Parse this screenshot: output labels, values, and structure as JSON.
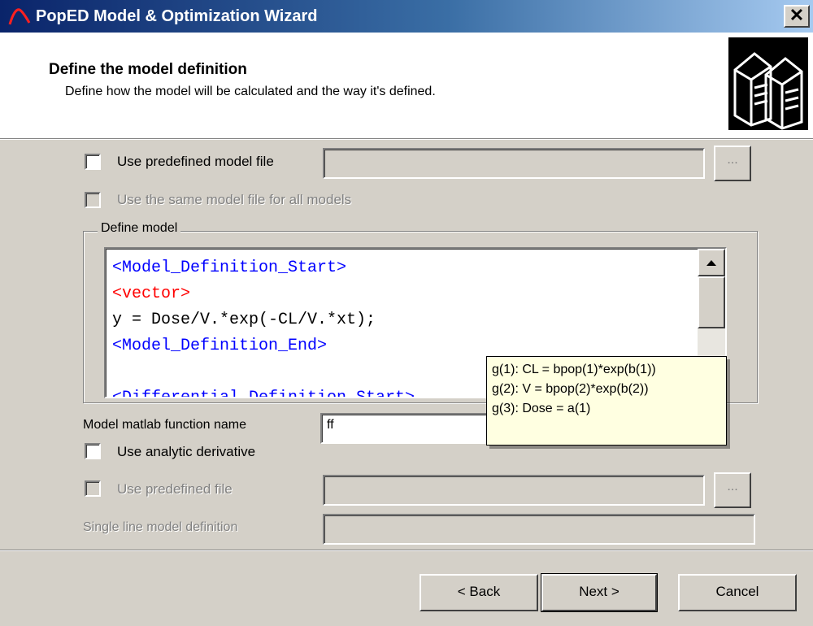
{
  "window": {
    "title": "PopED Model & Optimization Wizard",
    "close_label": "✕"
  },
  "header": {
    "title": "Define the model definition",
    "subtitle": "Define how the model will be calculated and the way it's defined."
  },
  "options": {
    "use_predefined_model_file": {
      "label": "Use predefined model file",
      "checked": false,
      "value": ""
    },
    "same_model_file_all": {
      "label": "Use the same model file for all models",
      "checked": false,
      "enabled": false
    },
    "browse_label": "..."
  },
  "define_model": {
    "group_label": "Define model",
    "code_lines": [
      {
        "text": "<Model_Definition_Start>",
        "color": "#0000ff"
      },
      {
        "text": "<vector>",
        "color": "#ff0000"
      },
      {
        "text": "y = Dose/V.*exp(-CL/V.*xt);",
        "color": "#000000"
      },
      {
        "text": "<Model_Definition_End>",
        "color": "#0000ff"
      },
      {
        "text": "",
        "color": "#000000"
      },
      {
        "text": "<Differential_Definition_Start>",
        "color": "#0000ff"
      }
    ]
  },
  "tooltip": {
    "lines": [
      "g(1): CL = bpop(1)*exp(b(1))",
      "g(2): V = bpop(2)*exp(b(2))",
      "g(3): Dose = a(1)"
    ]
  },
  "function_name": {
    "label": "Model matlab function name",
    "value": "ff"
  },
  "analytic_derivative": {
    "label": "Use analytic derivative",
    "checked": false
  },
  "predefined_file": {
    "label": "Use predefined file",
    "checked": false,
    "enabled": false,
    "value": ""
  },
  "single_line": {
    "label": "Single line model definition",
    "value": ""
  },
  "buttons": {
    "back": "< Back",
    "next": "Next >",
    "cancel": "Cancel"
  }
}
